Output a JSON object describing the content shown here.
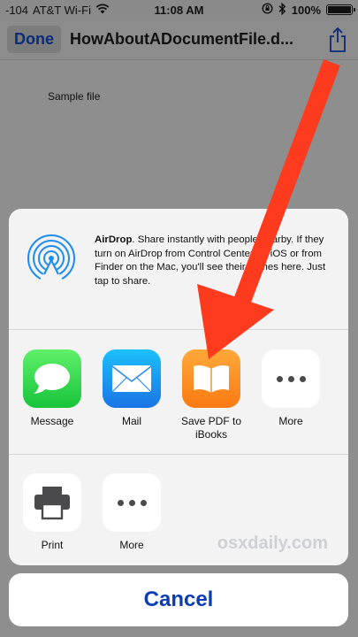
{
  "status_bar": {
    "signal": "-104",
    "carrier": "AT&T Wi-Fi",
    "time": "11:08 AM",
    "battery": "100%",
    "battery_level": 1.0,
    "icons": [
      "wifi-icon",
      "rotation-lock-icon",
      "bluetooth-icon",
      "battery-icon"
    ]
  },
  "nav": {
    "done_label": "Done",
    "title": "HowAboutADocumentFile.d...",
    "share_icon": "share-icon"
  },
  "document": {
    "content": "Sample file"
  },
  "share_sheet": {
    "airdrop": {
      "icon": "airdrop-icon",
      "title": "AirDrop",
      "description": ". Share instantly with people nearby. If they turn on AirDrop from Control Center on iOS or from Finder on the Mac, you'll see their names here. Just tap to share."
    },
    "apps": [
      {
        "label": "Message",
        "icon": "message-icon"
      },
      {
        "label": "Mail",
        "icon": "mail-icon"
      },
      {
        "label": "Save PDF to iBooks",
        "icon": "ibooks-icon"
      },
      {
        "label": "More",
        "icon": "more-icon"
      }
    ],
    "actions": [
      {
        "label": "Print",
        "icon": "print-icon"
      },
      {
        "label": "More",
        "icon": "more-icon"
      }
    ],
    "watermark": "osxdaily.com"
  },
  "cancel_label": "Cancel",
  "colors": {
    "accent": "#0b3db5",
    "annotation_arrow": "#ff3b1f",
    "dimmed_background": "#8e8e8e"
  }
}
